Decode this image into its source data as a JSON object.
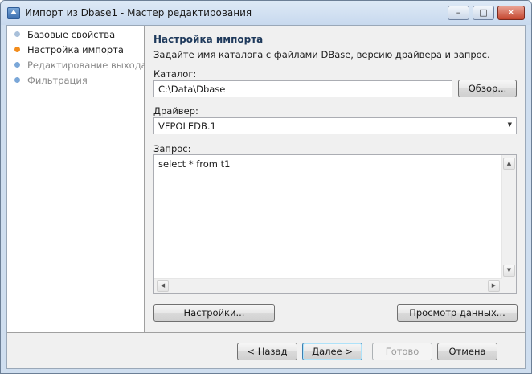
{
  "window": {
    "title": "Импорт из Dbase1 - Мастер редактирования",
    "minimize_glyph": "–",
    "maximize_glyph": "□",
    "close_glyph": "✕"
  },
  "steps": [
    {
      "label": "Базовые свойства",
      "state": "done",
      "dot_color": "#a9c0da",
      "text_color": "#1e1e1e"
    },
    {
      "label": "Настройка импорта",
      "state": "current",
      "dot_color": "#f28c1c",
      "text_color": "#1e1e1e"
    },
    {
      "label": "Редактирование выхода",
      "state": "pending",
      "dot_color": "#7aa7d8",
      "text_color": "#8a8a8a"
    },
    {
      "label": "Фильтрация",
      "state": "pending",
      "dot_color": "#7aa7d8",
      "text_color": "#8a8a8a"
    }
  ],
  "section": {
    "title": "Настройка импорта",
    "description": "Задайте имя каталога с файлами DBase, версию драйвера и запрос."
  },
  "catalog": {
    "label": "Каталог:",
    "value": "C:\\Data\\Dbase",
    "browse_label": "Обзор..."
  },
  "driver": {
    "label": "Драйвер:",
    "value": "VFPOLEDB.1",
    "dropdown_glyph": "▼"
  },
  "query": {
    "label": "Запрос:",
    "value": "select * from t1",
    "scroll_up_glyph": "▲",
    "scroll_down_glyph": "▼",
    "scroll_left_glyph": "◀",
    "scroll_right_glyph": "▶"
  },
  "actions": {
    "settings_label": "Настройки...",
    "preview_label": "Просмотр данных..."
  },
  "footer": {
    "back_label": "< Назад",
    "next_label": "Далее >",
    "finish_label": "Готово",
    "cancel_label": "Отмена"
  },
  "colors": {
    "section_title": "#1e395b",
    "default_button_border": "#3c7fb1"
  }
}
